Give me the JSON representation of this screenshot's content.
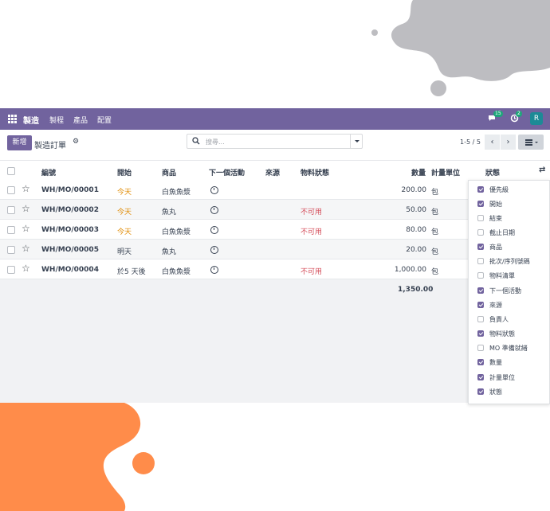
{
  "topbar": {
    "brand": "製造",
    "menu": [
      "製程",
      "產品",
      "配置"
    ],
    "chat_badge": "15",
    "activity_badge": "2",
    "avatar_letter": "R"
  },
  "control": {
    "new_label": "新增",
    "title": "製造訂單",
    "search_placeholder": "搜尋...",
    "pager": "1-5 / 5"
  },
  "columns": {
    "reference": "編號",
    "start": "開始",
    "product": "商品",
    "next_activity": "下一個活動",
    "source": "來源",
    "material_status": "物料狀態",
    "quantity": "數量",
    "uom": "計量單位",
    "state": "狀態"
  },
  "rows": [
    {
      "ref": "WH/MO/00001",
      "start": "今天",
      "product": "白魚魚漿",
      "material": "",
      "qty": "200.00",
      "uom": "包"
    },
    {
      "ref": "WH/MO/00002",
      "start": "今天",
      "product": "魚丸",
      "material": "不可用",
      "qty": "50.00",
      "uom": "包"
    },
    {
      "ref": "WH/MO/00003",
      "start": "今天",
      "product": "白魚魚漿",
      "material": "不可用",
      "qty": "80.00",
      "uom": "包"
    },
    {
      "ref": "WH/MO/00005",
      "start": "明天",
      "product": "魚丸",
      "material": "",
      "qty": "20.00",
      "uom": "包"
    },
    {
      "ref": "WH/MO/00004",
      "start": "於5 天後",
      "product": "白魚魚漿",
      "material": "不可用",
      "qty": "1,000.00",
      "uom": "包"
    }
  ],
  "total_qty": "1,350.00",
  "optional_columns": [
    {
      "label": "優先級",
      "checked": true
    },
    {
      "label": "開始",
      "checked": true
    },
    {
      "label": "結束",
      "checked": false
    },
    {
      "label": "截止日期",
      "checked": false
    },
    {
      "label": "商品",
      "checked": true
    },
    {
      "label": "批次/序列號碼",
      "checked": false
    },
    {
      "label": "物料清單",
      "checked": false
    },
    {
      "label": "下一個活動",
      "checked": true
    },
    {
      "label": "來源",
      "checked": true
    },
    {
      "label": "負責人",
      "checked": false
    },
    {
      "label": "物料狀態",
      "checked": true
    },
    {
      "label": "MO 準備就緒",
      "checked": false
    },
    {
      "label": "數量",
      "checked": true
    },
    {
      "label": "計量單位",
      "checked": true
    },
    {
      "label": "狀態",
      "checked": true
    }
  ],
  "colors": {
    "brand_purple": "#71639e",
    "splash_orange": "#ff8c4a",
    "splash_gray": "#bdbdc1",
    "today_orange": "#e08a00",
    "unavailable_red": "#d44c59"
  }
}
